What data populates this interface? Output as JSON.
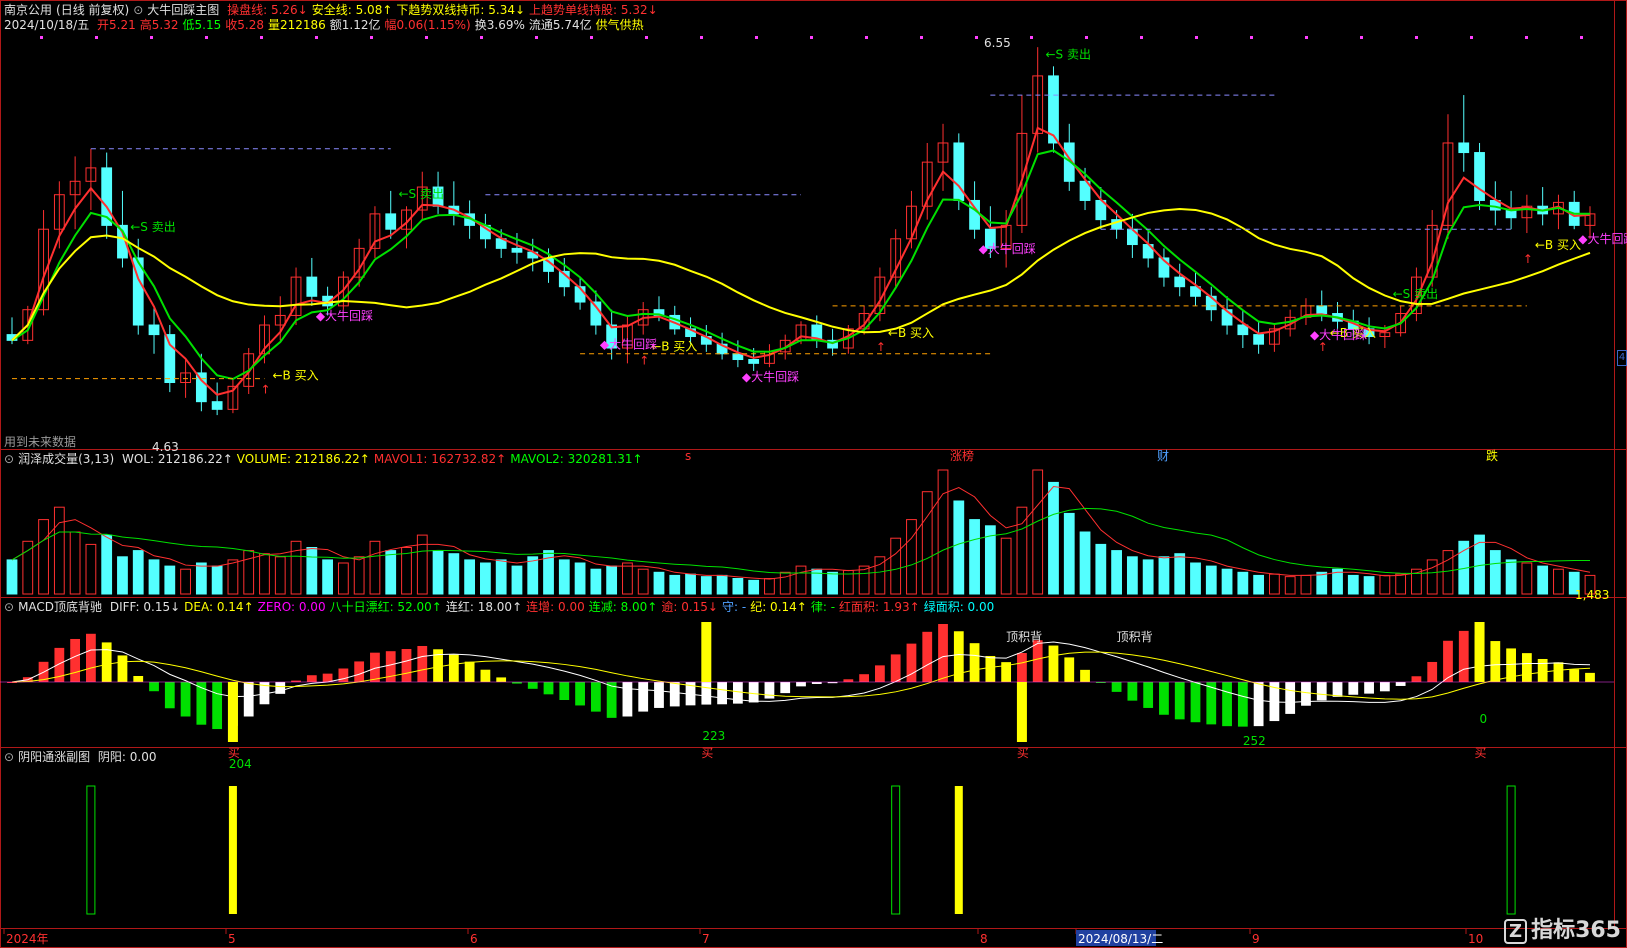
{
  "header": {
    "stock": "南京公用",
    "mode": "(日线 前复权)",
    "indicator": "大牛回踩主图",
    "line1": [
      {
        "label": "操盘线: 5.26↓",
        "color": "#ff3030"
      },
      {
        "label": "安全线: 5.08↑",
        "color": "#ffff00"
      },
      {
        "label": "下趋势双线持币: 5.34↓",
        "color": "#ffff00"
      },
      {
        "label": "上趋势单线持股: 5.32↓",
        "color": "#ff3030"
      }
    ],
    "date": "2024/10/18/五",
    "line2": [
      {
        "label": "开5.21",
        "color": "#ff3030"
      },
      {
        "label": "高5.32",
        "color": "#ff3030"
      },
      {
        "label": "低5.15",
        "color": "#00ff00"
      },
      {
        "label": "收5.28",
        "color": "#ff3030"
      },
      {
        "label": "量212186",
        "color": "#ffff00"
      },
      {
        "label": "额1.12亿",
        "color": "#e0e0e0"
      },
      {
        "label": "幅0.06(1.15%)",
        "color": "#ff3030"
      },
      {
        "label": "换3.69%",
        "color": "#e0e0e0"
      },
      {
        "label": "流通5.74亿",
        "color": "#e0e0e0"
      },
      {
        "label": "供气供热",
        "color": "#ffff00"
      }
    ]
  },
  "main_labels": {
    "high_price": "6.55",
    "low_price": "4.63",
    "future_data": "用到未来数据",
    "events": [
      "s",
      "涨榜",
      "财",
      "跌"
    ],
    "buy": "←B 买入",
    "sell": "←S 卖出",
    "dnhc": "大牛回踩"
  },
  "volume_panel": {
    "title": "润泽成交量(3,13)",
    "items": [
      {
        "label": "WOL: 212186.22↑",
        "color": "#e0e0e0"
      },
      {
        "label": "VOLUME: 212186.22↑",
        "color": "#ffff00"
      },
      {
        "label": "MAVOL1: 162732.82↑",
        "color": "#ff3030"
      },
      {
        "label": "MAVOL2: 320281.31↑",
        "color": "#00ff00"
      }
    ],
    "axis_value": "1,483"
  },
  "macd_panel": {
    "title": "MACD顶底背驰",
    "items": [
      {
        "label": "DIFF: 0.15↓",
        "color": "#e0e0e0"
      },
      {
        "label": "DEA: 0.14↑",
        "color": "#ffff00"
      },
      {
        "label": "ZERO: 0.00",
        "color": "#ff00ff"
      },
      {
        "label": "八十日漂红: 52.00↑",
        "color": "#00ff00"
      },
      {
        "label": "连红: 18.00↑",
        "color": "#e0e0e0"
      },
      {
        "label": "连增: 0.00",
        "color": "#ff3030"
      },
      {
        "label": "连减: 8.00↑",
        "color": "#00ff00"
      },
      {
        "label": "逾: 0.15↓",
        "color": "#ff3030"
      },
      {
        "label": "守: -",
        "color": "#4fa0ff"
      },
      {
        "label": "纪: 0.14↑",
        "color": "#ffff00"
      },
      {
        "label": "律: -",
        "color": "#00ff00"
      },
      {
        "label": "红面积: 1.93↑",
        "color": "#ff3030"
      },
      {
        "label": "绿面积: 0.00",
        "color": "#00ffff"
      }
    ],
    "top_div": "顶积背",
    "buy_char": "买",
    "nums": [
      "223",
      "252",
      "0",
      "204"
    ]
  },
  "yinyang_panel": {
    "title": "阴阳通涨副图",
    "items": [
      {
        "label": "阴阳: 0.00",
        "color": "#e0e0e0"
      }
    ]
  },
  "x_axis": [
    "2024年",
    "5",
    "6",
    "7",
    "8",
    "2024/08/13/二",
    "9",
    "10"
  ],
  "watermark": "指标365",
  "right_marker": "4",
  "colors": {
    "up": "#ff3030",
    "down": "#54ffff",
    "green": "#00e000",
    "yellow": "#ffff00",
    "magenta": "#ff40ff",
    "bg": "#000000",
    "border": "#b01818"
  },
  "chart_data": [
    {
      "type": "candlestick",
      "title": "大牛回踩主图",
      "ylim": [
        4.5,
        6.65
      ],
      "annotations": {
        "max": 6.55,
        "min": 4.63
      },
      "series": [
        {
          "name": "操盘线",
          "value_last": 5.26
        },
        {
          "name": "安全线",
          "value_last": 5.08
        }
      ],
      "candles": [
        [
          5.05,
          5.14,
          5.0,
          5.02
        ],
        [
          5.02,
          5.2,
          5.0,
          5.18
        ],
        [
          5.18,
          5.7,
          5.15,
          5.6
        ],
        [
          5.6,
          5.85,
          5.5,
          5.78
        ],
        [
          5.78,
          5.98,
          5.6,
          5.85
        ],
        [
          5.85,
          6.02,
          5.7,
          5.92
        ],
        [
          5.92,
          6.0,
          5.55,
          5.62
        ],
        [
          5.62,
          5.8,
          5.4,
          5.45
        ],
        [
          5.45,
          5.55,
          5.05,
          5.1
        ],
        [
          5.1,
          5.2,
          4.95,
          5.05
        ],
        [
          5.05,
          5.1,
          4.75,
          4.8
        ],
        [
          4.8,
          4.92,
          4.72,
          4.85
        ],
        [
          4.85,
          4.95,
          4.65,
          4.7
        ],
        [
          4.7,
          4.8,
          4.63,
          4.66
        ],
        [
          4.66,
          4.82,
          4.64,
          4.78
        ],
        [
          4.78,
          4.98,
          4.74,
          4.95
        ],
        [
          4.95,
          5.15,
          4.9,
          5.1
        ],
        [
          5.1,
          5.25,
          5.02,
          5.15
        ],
        [
          5.15,
          5.4,
          5.1,
          5.35
        ],
        [
          5.35,
          5.45,
          5.2,
          5.25
        ],
        [
          5.25,
          5.3,
          5.15,
          5.2
        ],
        [
          5.2,
          5.38,
          5.18,
          5.35
        ],
        [
          5.35,
          5.55,
          5.3,
          5.5
        ],
        [
          5.5,
          5.72,
          5.45,
          5.68
        ],
        [
          5.68,
          5.8,
          5.55,
          5.6
        ],
        [
          5.6,
          5.72,
          5.5,
          5.7
        ],
        [
          5.7,
          5.9,
          5.65,
          5.82
        ],
        [
          5.82,
          5.9,
          5.68,
          5.72
        ],
        [
          5.72,
          5.85,
          5.62,
          5.68
        ],
        [
          5.68,
          5.75,
          5.55,
          5.62
        ],
        [
          5.62,
          5.68,
          5.5,
          5.55
        ],
        [
          5.55,
          5.6,
          5.45,
          5.5
        ],
        [
          5.5,
          5.58,
          5.42,
          5.48
        ],
        [
          5.48,
          5.55,
          5.38,
          5.45
        ],
        [
          5.45,
          5.5,
          5.32,
          5.38
        ],
        [
          5.38,
          5.45,
          5.25,
          5.3
        ],
        [
          5.3,
          5.35,
          5.18,
          5.22
        ],
        [
          5.22,
          5.28,
          5.05,
          5.1
        ],
        [
          5.1,
          5.18,
          4.92,
          4.98
        ],
        [
          4.98,
          5.15,
          4.9,
          5.1
        ],
        [
          5.1,
          5.22,
          5.05,
          5.18
        ],
        [
          5.18,
          5.25,
          5.12,
          5.15
        ],
        [
          5.15,
          5.2,
          5.05,
          5.08
        ],
        [
          5.08,
          5.14,
          5.0,
          5.04
        ],
        [
          5.04,
          5.1,
          4.96,
          5.0
        ],
        [
          5.0,
          5.06,
          4.92,
          4.95
        ],
        [
          4.95,
          5.02,
          4.88,
          4.92
        ],
        [
          4.92,
          4.98,
          4.86,
          4.9
        ],
        [
          4.9,
          5.0,
          4.88,
          4.96
        ],
        [
          4.96,
          5.05,
          4.92,
          5.02
        ],
        [
          5.02,
          5.12,
          5.0,
          5.1
        ],
        [
          5.1,
          5.15,
          4.98,
          5.02
        ],
        [
          5.02,
          5.08,
          4.94,
          4.98
        ],
        [
          4.98,
          5.1,
          4.95,
          5.08
        ],
        [
          5.08,
          5.2,
          5.05,
          5.16
        ],
        [
          5.16,
          5.4,
          5.12,
          5.35
        ],
        [
          5.35,
          5.6,
          5.3,
          5.55
        ],
        [
          5.55,
          5.8,
          5.5,
          5.72
        ],
        [
          5.72,
          6.05,
          5.65,
          5.95
        ],
        [
          5.95,
          6.15,
          5.8,
          6.05
        ],
        [
          6.05,
          6.1,
          5.7,
          5.75
        ],
        [
          5.75,
          5.85,
          5.55,
          5.6
        ],
        [
          5.6,
          5.72,
          5.45,
          5.5
        ],
        [
          5.5,
          5.7,
          5.4,
          5.62
        ],
        [
          5.62,
          6.3,
          5.58,
          6.1
        ],
        [
          6.1,
          6.55,
          6.0,
          6.4
        ],
        [
          6.4,
          6.45,
          6.0,
          6.05
        ],
        [
          6.05,
          6.15,
          5.8,
          5.85
        ],
        [
          5.85,
          5.92,
          5.7,
          5.75
        ],
        [
          5.75,
          5.82,
          5.6,
          5.65
        ],
        [
          5.65,
          5.7,
          5.55,
          5.6
        ],
        [
          5.6,
          5.68,
          5.45,
          5.52
        ],
        [
          5.52,
          5.6,
          5.4,
          5.45
        ],
        [
          5.45,
          5.5,
          5.3,
          5.35
        ],
        [
          5.35,
          5.42,
          5.25,
          5.3
        ],
        [
          5.3,
          5.38,
          5.2,
          5.25
        ],
        [
          5.25,
          5.3,
          5.12,
          5.18
        ],
        [
          5.18,
          5.25,
          5.05,
          5.1
        ],
        [
          5.1,
          5.18,
          4.98,
          5.05
        ],
        [
          5.05,
          5.12,
          4.95,
          5.0
        ],
        [
          5.0,
          5.1,
          4.96,
          5.08
        ],
        [
          5.08,
          5.18,
          5.04,
          5.14
        ],
        [
          5.14,
          5.24,
          5.1,
          5.2
        ],
        [
          5.2,
          5.28,
          5.12,
          5.16
        ],
        [
          5.16,
          5.22,
          5.08,
          5.12
        ],
        [
          5.12,
          5.18,
          5.04,
          5.08
        ],
        [
          5.08,
          5.14,
          5.0,
          5.04
        ],
        [
          5.04,
          5.1,
          4.98,
          5.06
        ],
        [
          5.06,
          5.2,
          5.04,
          5.16
        ],
        [
          5.16,
          5.4,
          5.12,
          5.35
        ],
        [
          5.35,
          5.7,
          5.3,
          5.62
        ],
        [
          5.62,
          6.2,
          5.55,
          6.05
        ],
        [
          6.05,
          6.3,
          5.9,
          6.0
        ],
        [
          6.0,
          6.05,
          5.7,
          5.75
        ],
        [
          5.75,
          5.85,
          5.62,
          5.7
        ],
        [
          5.7,
          5.8,
          5.6,
          5.66
        ],
        [
          5.66,
          5.78,
          5.58,
          5.72
        ],
        [
          5.72,
          5.82,
          5.62,
          5.68
        ],
        [
          5.68,
          5.78,
          5.6,
          5.74
        ],
        [
          5.74,
          5.8,
          5.6,
          5.62
        ],
        [
          5.62,
          5.72,
          5.55,
          5.68
        ]
      ],
      "volumes": [
        55,
        85,
        120,
        140,
        100,
        80,
        95,
        60,
        70,
        55,
        45,
        40,
        50,
        45,
        55,
        70,
        65,
        60,
        85,
        75,
        55,
        50,
        60,
        85,
        70,
        75,
        95,
        70,
        65,
        55,
        50,
        55,
        45,
        60,
        70,
        55,
        50,
        40,
        45,
        50,
        40,
        35,
        30,
        32,
        28,
        30,
        25,
        22,
        25,
        35,
        45,
        40,
        35,
        38,
        45,
        60,
        90,
        120,
        165,
        200,
        150,
        120,
        110,
        90,
        140,
        200,
        180,
        130,
        100,
        80,
        70,
        60,
        55,
        60,
        65,
        50,
        45,
        40,
        35,
        30,
        32,
        28,
        30,
        35,
        40,
        30,
        28,
        30,
        32,
        40,
        55,
        70,
        85,
        95,
        70,
        55,
        50,
        45,
        40,
        35,
        30
      ]
    }
  ]
}
